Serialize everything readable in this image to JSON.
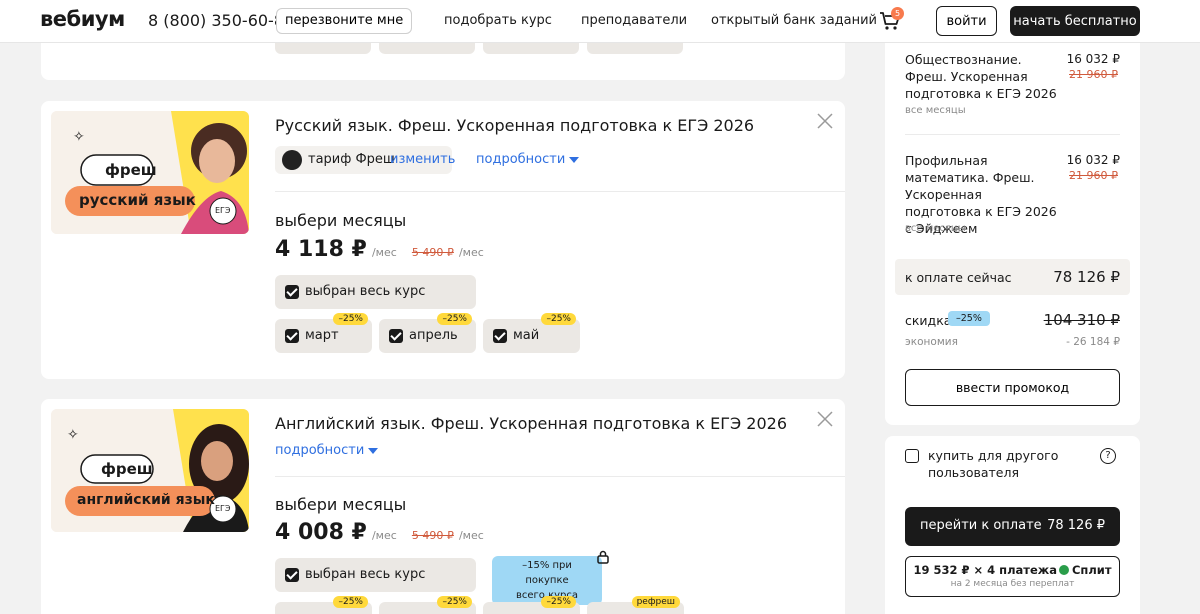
{
  "header": {
    "logo": "вебиум",
    "phone": "8 (800) 350-60-87",
    "callback_label": "перезвоните мне",
    "nav": [
      "подобрать курс",
      "преподаватели",
      "открытый банк заданий"
    ],
    "cart_count": "5",
    "login_label": "войти",
    "start_label": "начать бесплатно"
  },
  "courses": [
    {
      "title": "Русский язык. Фреш. Ускоренная подготовка к ЕГЭ 2026",
      "image": {
        "brand": "фреш",
        "subject": "русский язык",
        "exam": "ЕГЭ"
      },
      "tariff_label": "тариф Фреш",
      "tariff_change": "изменить",
      "details_label": "подробности",
      "months_heading": "выбери месяцы",
      "price": "4 118 ₽",
      "per_month": "/мес",
      "old_price": "5 490 ₽",
      "old_per_month": "/мес",
      "whole_course_label": "выбран весь курс",
      "months": [
        {
          "label": "март",
          "discount": "–25%"
        },
        {
          "label": "апрель",
          "discount": "–25%"
        },
        {
          "label": "май",
          "discount": "–25%"
        }
      ]
    },
    {
      "title": "Английский язык. Фреш. Ускоренная подготовка к ЕГЭ 2026",
      "image": {
        "brand": "фреш",
        "subject": "английский язык",
        "exam": "ЕГЭ"
      },
      "details_label": "подробности",
      "months_heading": "выбери месяцы",
      "price": "4 008 ₽",
      "per_month": "/мес",
      "old_price": "5 490 ₽",
      "old_per_month": "/мес",
      "whole_course_label": "выбран весь курс",
      "promo_line1": "–15% при покупке",
      "promo_line2": "всего курса",
      "months": [
        {
          "discount": "–25%"
        },
        {
          "discount": "–25%"
        },
        {
          "discount": "–25%"
        },
        {
          "discount": "рефреш"
        }
      ]
    }
  ],
  "summary": {
    "items": [
      {
        "title": "Обществознание. Фреш. Ускоренная подготовка к ЕГЭ 2026",
        "price": "16 032 ₽",
        "old_price": "21 960 ₽",
        "sub": "все месяцы"
      },
      {
        "title": "Профильная математика. Фреш. Ускоренная подготовка к ЕГЭ 2026 с Эйджеем",
        "price": "16 032 ₽",
        "old_price": "21 960 ₽",
        "sub": "все месяцы"
      }
    ],
    "pay_now_label": "к оплате сейчас",
    "pay_now_value": "78 126 ₽",
    "discount_label": "скидка",
    "discount_badge": "–25%",
    "discount_old_total": "104 310 ₽",
    "economy_label": "экономия",
    "economy_value": "- 26 184 ₽",
    "promo_button": "ввести промокод"
  },
  "checkout": {
    "gift_label": "купить для другого пользователя",
    "help_label": "?",
    "go_pay_label": "перейти к оплате",
    "go_pay_value": "78 126 ₽",
    "split_text_before": "19 532 ₽ × 4 платежа",
    "split_brand": "Сплит",
    "split_sub": "на 2 месяца без переплат"
  },
  "colors": {
    "accent": "#2f6fe0",
    "badge": "#ffd93b",
    "discount_blue": "#9fd8f5",
    "old_price": "#d05a3c",
    "dark": "#1a1a1a"
  }
}
